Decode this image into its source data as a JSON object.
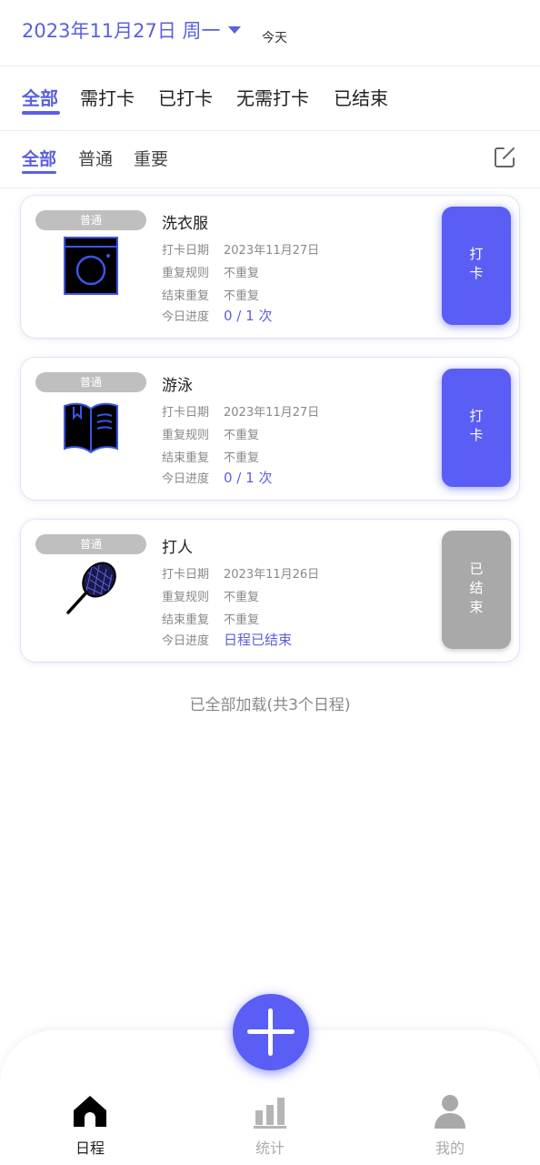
{
  "header": {
    "date": "2023年11月27日 周一",
    "today_label": "今天"
  },
  "status_tabs": [
    "全部",
    "需打卡",
    "已打卡",
    "无需打卡",
    "已结束"
  ],
  "type_tabs": [
    "全部",
    "普通",
    "重要"
  ],
  "labels": {
    "date": "打卡日期",
    "repeat": "重复规则",
    "end_repeat": "结束重复",
    "progress": "今日进度"
  },
  "cards": [
    {
      "badge": "普通",
      "title": "洗衣服",
      "icon": "washing-machine-icon",
      "date": "2023年11月27日",
      "repeat": "不重复",
      "end_repeat": "不重复",
      "progress": "0 / 1 次",
      "action": "打卡"
    },
    {
      "badge": "普通",
      "title": "游泳",
      "icon": "open-book-icon",
      "date": "2023年11月27日",
      "repeat": "不重复",
      "end_repeat": "不重复",
      "progress": "0 / 1 次",
      "action": "打卡"
    },
    {
      "badge": "普通",
      "title": "打人",
      "icon": "tennis-racket-icon",
      "date": "2023年11月26日",
      "repeat": "不重复",
      "end_repeat": "不重复",
      "progress": "日程已结束",
      "action": "已结束"
    }
  ],
  "footer_note": "已全部加载(共3个日程)",
  "bottom_nav": [
    {
      "label": "日程",
      "icon": "home-icon"
    },
    {
      "label": "统计",
      "icon": "bar-chart-icon"
    },
    {
      "label": "我的",
      "icon": "user-icon"
    }
  ],
  "colors": {
    "accent": "#5b5fe0",
    "button": "#5a5ef4",
    "ended": "#a9a9a9",
    "badge": "#bfbfbf"
  }
}
